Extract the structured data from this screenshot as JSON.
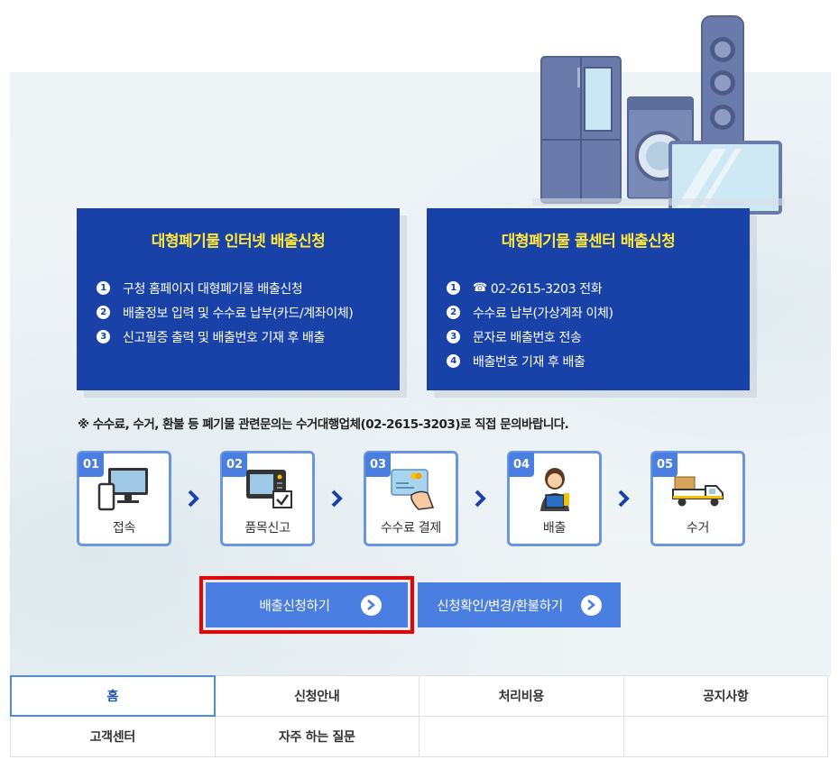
{
  "internet_box": {
    "title": "대형폐기물 인터넷 배출신청",
    "items": [
      {
        "num": "1",
        "text": "구청 홈페이지 대형폐기물 배출신청"
      },
      {
        "num": "2",
        "text": "배출정보 입력 및 수수료 납부(카드/계좌이체)"
      },
      {
        "num": "3",
        "text": "신고필증 출력 및 배출번호 기재 후 배출"
      }
    ]
  },
  "callcenter_box": {
    "title": "대형폐기물 콜센터 배출신청",
    "items": [
      {
        "num": "1",
        "icon": "☎",
        "text": "02-2615-3203 전화"
      },
      {
        "num": "2",
        "text": "수수료 납부(가상계좌 이체)"
      },
      {
        "num": "3",
        "text": "문자로 배출번호 전송"
      },
      {
        "num": "4",
        "text": "배출번호 기재 후 배출"
      }
    ]
  },
  "notice": "※ 수수료, 수거, 환불 등 폐기물 관련문의는 수거대행업체(02-2615-3203)로 직접 문의바랍니다.",
  "steps": [
    {
      "num": "01",
      "label": "접속",
      "icon": "computer-icon"
    },
    {
      "num": "02",
      "label": "품목신고",
      "icon": "microwave-check-icon"
    },
    {
      "num": "03",
      "label": "수수료 결제",
      "icon": "card-payment-icon"
    },
    {
      "num": "04",
      "label": "배출",
      "icon": "person-tv-icon"
    },
    {
      "num": "05",
      "label": "수거",
      "icon": "truck-icon"
    }
  ],
  "buttons": {
    "apply": "배출신청하기",
    "check": "신청확인/변경/환불하기"
  },
  "nav": {
    "row1": [
      "홈",
      "신청안내",
      "처리비용",
      "공지사항"
    ],
    "row2": [
      "고객센터",
      "자주 하는 질문"
    ]
  },
  "colors": {
    "box_blue": "#1942a8",
    "title_yellow": "#ffe83a",
    "accent_blue": "#4a7ee0",
    "highlight_red": "#ee0000"
  }
}
